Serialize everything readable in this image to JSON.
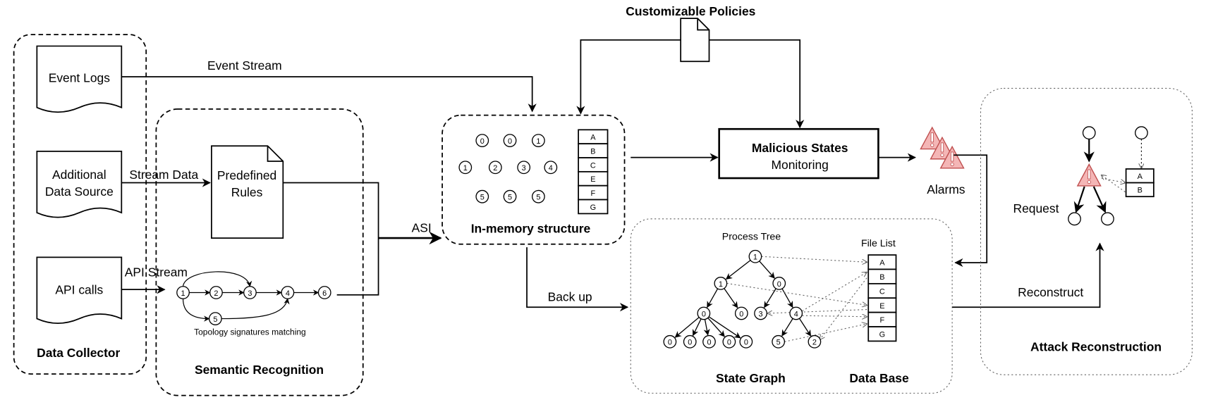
{
  "colors": {
    "alarm_fill": "#f4b6b6",
    "alarm_stroke": "#c05050",
    "line": "#000000"
  },
  "data_collector": {
    "title": "Data Collector",
    "sources": {
      "event_logs": "Event Logs",
      "additional_1": "Additional",
      "additional_2": "Data Source",
      "api_calls": "API calls"
    }
  },
  "semantic": {
    "title": "Semantic Recognition",
    "rules_1": "Predefined",
    "rules_2": "Rules",
    "topology_caption": "Topology signatures matching",
    "topology_nodes": [
      "1",
      "2",
      "3",
      "4",
      "6",
      "5"
    ]
  },
  "edges": {
    "event_stream": "Event Stream",
    "stream_data": "Stream Data",
    "api_stream": "API Stream",
    "asi": "ASI",
    "back_up": "Back up",
    "request": "Request",
    "reconstruct": "Reconstruct"
  },
  "memory": {
    "title": "In-memory structure",
    "nodes": [
      "0",
      "0",
      "1",
      "1",
      "2",
      "3",
      "4",
      "5",
      "5",
      "5"
    ],
    "table": [
      "A",
      "B",
      "C",
      "E",
      "F",
      "G"
    ]
  },
  "policies": {
    "title": "Customizable Policies",
    "icon": "document-icon"
  },
  "monitor": {
    "line1": "Malicious States",
    "line2": "Monitoring"
  },
  "alarms": {
    "label": "Alarms",
    "icon": "warning-triangle-icon"
  },
  "state_graph": {
    "title": "State Graph",
    "db_title": "Data Base",
    "process_tree_label": "Process Tree",
    "file_list_label": "File List",
    "tree_nodes": [
      "1",
      "1",
      "0",
      "0",
      "0",
      "3",
      "4",
      "0",
      "0",
      "0",
      "0",
      "0",
      "5",
      "2"
    ],
    "file_list": [
      "A",
      "B",
      "C",
      "E",
      "F",
      "G"
    ]
  },
  "attack": {
    "title": "Attack Reconstruction",
    "table": [
      "A",
      "B"
    ]
  }
}
